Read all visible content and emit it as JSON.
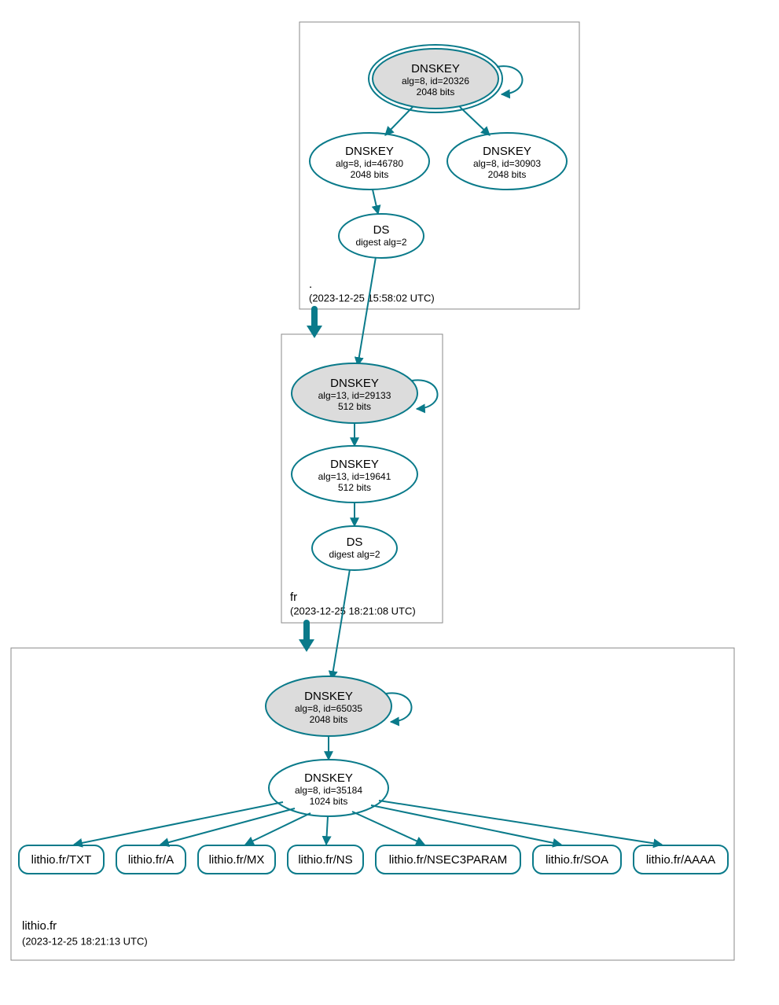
{
  "colors": {
    "stroke": "#0a7a8a",
    "grey": "#dcdcdc"
  },
  "zones": {
    "root": {
      "name": ".",
      "ts": "(2023-12-25 15:58:02 UTC)"
    },
    "fr": {
      "name": "fr",
      "ts": "(2023-12-25 18:21:08 UTC)"
    },
    "dom": {
      "name": "lithio.fr",
      "ts": "(2023-12-25 18:21:13 UTC)"
    }
  },
  "root": {
    "ksk": {
      "title": "DNSKEY",
      "line1": "alg=8, id=20326",
      "line2": "2048 bits"
    },
    "zsk1": {
      "title": "DNSKEY",
      "line1": "alg=8, id=46780",
      "line2": "2048 bits"
    },
    "zsk2": {
      "title": "DNSKEY",
      "line1": "alg=8, id=30903",
      "line2": "2048 bits"
    },
    "ds": {
      "title": "DS",
      "line1": "digest alg=2"
    }
  },
  "fr": {
    "ksk": {
      "title": "DNSKEY",
      "line1": "alg=13, id=29133",
      "line2": "512 bits"
    },
    "zsk": {
      "title": "DNSKEY",
      "line1": "alg=13, id=19641",
      "line2": "512 bits"
    },
    "ds": {
      "title": "DS",
      "line1": "digest alg=2"
    }
  },
  "dom": {
    "ksk": {
      "title": "DNSKEY",
      "line1": "alg=8, id=65035",
      "line2": "2048 bits"
    },
    "zsk": {
      "title": "DNSKEY",
      "line1": "alg=8, id=35184",
      "line2": "1024 bits"
    }
  },
  "rr": {
    "txt": "lithio.fr/TXT",
    "a": "lithio.fr/A",
    "mx": "lithio.fr/MX",
    "ns": "lithio.fr/NS",
    "n3p": "lithio.fr/NSEC3PARAM",
    "soa": "lithio.fr/SOA",
    "aaaa": "lithio.fr/AAAA"
  },
  "chart_data": {
    "type": "graph",
    "description": "DNSSEC delegation / signing graph for lithio.fr",
    "zones": [
      {
        "name": ".",
        "timestamp": "2023-12-25 15:58:02 UTC"
      },
      {
        "name": "fr",
        "timestamp": "2023-12-25 18:21:08 UTC"
      },
      {
        "name": "lithio.fr",
        "timestamp": "2023-12-25 18:21:13 UTC"
      }
    ],
    "nodes": [
      {
        "id": "root-ksk",
        "zone": ".",
        "type": "DNSKEY",
        "alg": 8,
        "keyid": 20326,
        "bits": 2048,
        "ksk": true
      },
      {
        "id": "root-zsk1",
        "zone": ".",
        "type": "DNSKEY",
        "alg": 8,
        "keyid": 46780,
        "bits": 2048
      },
      {
        "id": "root-zsk2",
        "zone": ".",
        "type": "DNSKEY",
        "alg": 8,
        "keyid": 30903,
        "bits": 2048
      },
      {
        "id": "root-ds",
        "zone": ".",
        "type": "DS",
        "digest_alg": 2
      },
      {
        "id": "fr-ksk",
        "zone": "fr",
        "type": "DNSKEY",
        "alg": 13,
        "keyid": 29133,
        "bits": 512,
        "ksk": true
      },
      {
        "id": "fr-zsk",
        "zone": "fr",
        "type": "DNSKEY",
        "alg": 13,
        "keyid": 19641,
        "bits": 512
      },
      {
        "id": "fr-ds",
        "zone": "fr",
        "type": "DS",
        "digest_alg": 2
      },
      {
        "id": "dom-ksk",
        "zone": "lithio.fr",
        "type": "DNSKEY",
        "alg": 8,
        "keyid": 65035,
        "bits": 2048,
        "ksk": true
      },
      {
        "id": "dom-zsk",
        "zone": "lithio.fr",
        "type": "DNSKEY",
        "alg": 8,
        "keyid": 35184,
        "bits": 1024
      },
      {
        "id": "rr-txt",
        "zone": "lithio.fr",
        "type": "RRset",
        "name": "lithio.fr/TXT"
      },
      {
        "id": "rr-a",
        "zone": "lithio.fr",
        "type": "RRset",
        "name": "lithio.fr/A"
      },
      {
        "id": "rr-mx",
        "zone": "lithio.fr",
        "type": "RRset",
        "name": "lithio.fr/MX"
      },
      {
        "id": "rr-ns",
        "zone": "lithio.fr",
        "type": "RRset",
        "name": "lithio.fr/NS"
      },
      {
        "id": "rr-n3p",
        "zone": "lithio.fr",
        "type": "RRset",
        "name": "lithio.fr/NSEC3PARAM"
      },
      {
        "id": "rr-soa",
        "zone": "lithio.fr",
        "type": "RRset",
        "name": "lithio.fr/SOA"
      },
      {
        "id": "rr-aaaa",
        "zone": "lithio.fr",
        "type": "RRset",
        "name": "lithio.fr/AAAA"
      }
    ],
    "edges": [
      {
        "from": "root-ksk",
        "to": "root-ksk"
      },
      {
        "from": "root-ksk",
        "to": "root-zsk1"
      },
      {
        "from": "root-ksk",
        "to": "root-zsk2"
      },
      {
        "from": "root-zsk1",
        "to": "root-ds"
      },
      {
        "from": "root-ds",
        "to": "fr-ksk"
      },
      {
        "from": "fr-ksk",
        "to": "fr-ksk"
      },
      {
        "from": "fr-ksk",
        "to": "fr-zsk"
      },
      {
        "from": "fr-zsk",
        "to": "fr-ds"
      },
      {
        "from": "fr-ds",
        "to": "dom-ksk"
      },
      {
        "from": "dom-ksk",
        "to": "dom-ksk"
      },
      {
        "from": "dom-ksk",
        "to": "dom-zsk"
      },
      {
        "from": "dom-zsk",
        "to": "rr-txt"
      },
      {
        "from": "dom-zsk",
        "to": "rr-a"
      },
      {
        "from": "dom-zsk",
        "to": "rr-mx"
      },
      {
        "from": "dom-zsk",
        "to": "rr-ns"
      },
      {
        "from": "dom-zsk",
        "to": "rr-n3p"
      },
      {
        "from": "dom-zsk",
        "to": "rr-soa"
      },
      {
        "from": "dom-zsk",
        "to": "rr-aaaa"
      }
    ]
  }
}
